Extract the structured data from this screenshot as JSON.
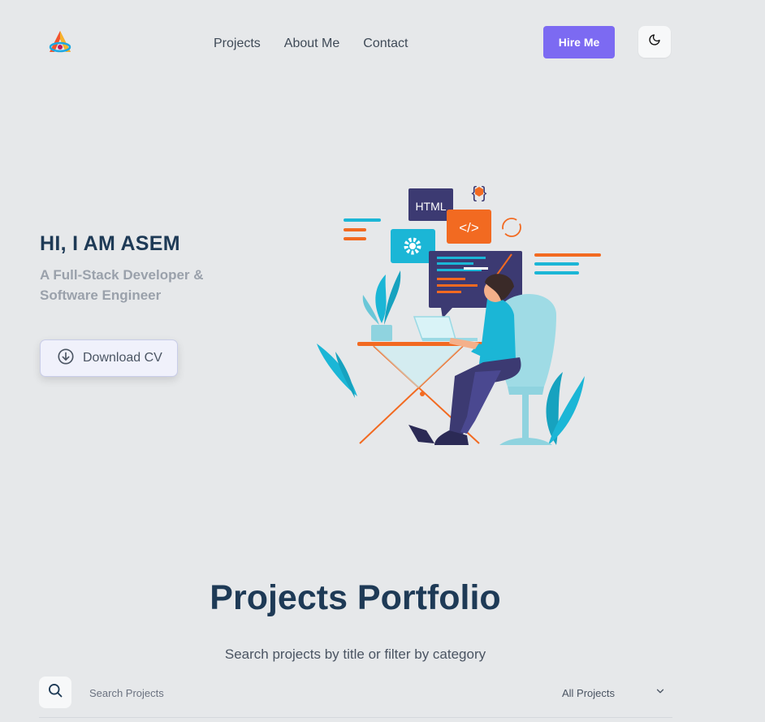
{
  "header": {
    "logo_icon": "triangle-logo-icon",
    "nav": [
      "Projects",
      "About Me",
      "Contact"
    ],
    "hire_label": "Hire Me",
    "theme_icon": "moon-icon",
    "accent": "#7c6af2"
  },
  "hero": {
    "title": "HI, I AM ASEM",
    "subtitle": "A Full-Stack Developer & Software Engineer",
    "cv_label": "Download CV",
    "cv_icon": "download-circle-icon",
    "illustration": {
      "html_tag": "HTML",
      "code_tag": "</>",
      "braces_tag": "{ }"
    }
  },
  "portfolio": {
    "title": "Projects Portfolio",
    "subtitle": "Search projects by title or filter by category",
    "search_placeholder": "Search Projects",
    "filter_value": "All Projects",
    "search_icon": "search-icon",
    "chevron_icon": "chevron-down-icon"
  }
}
